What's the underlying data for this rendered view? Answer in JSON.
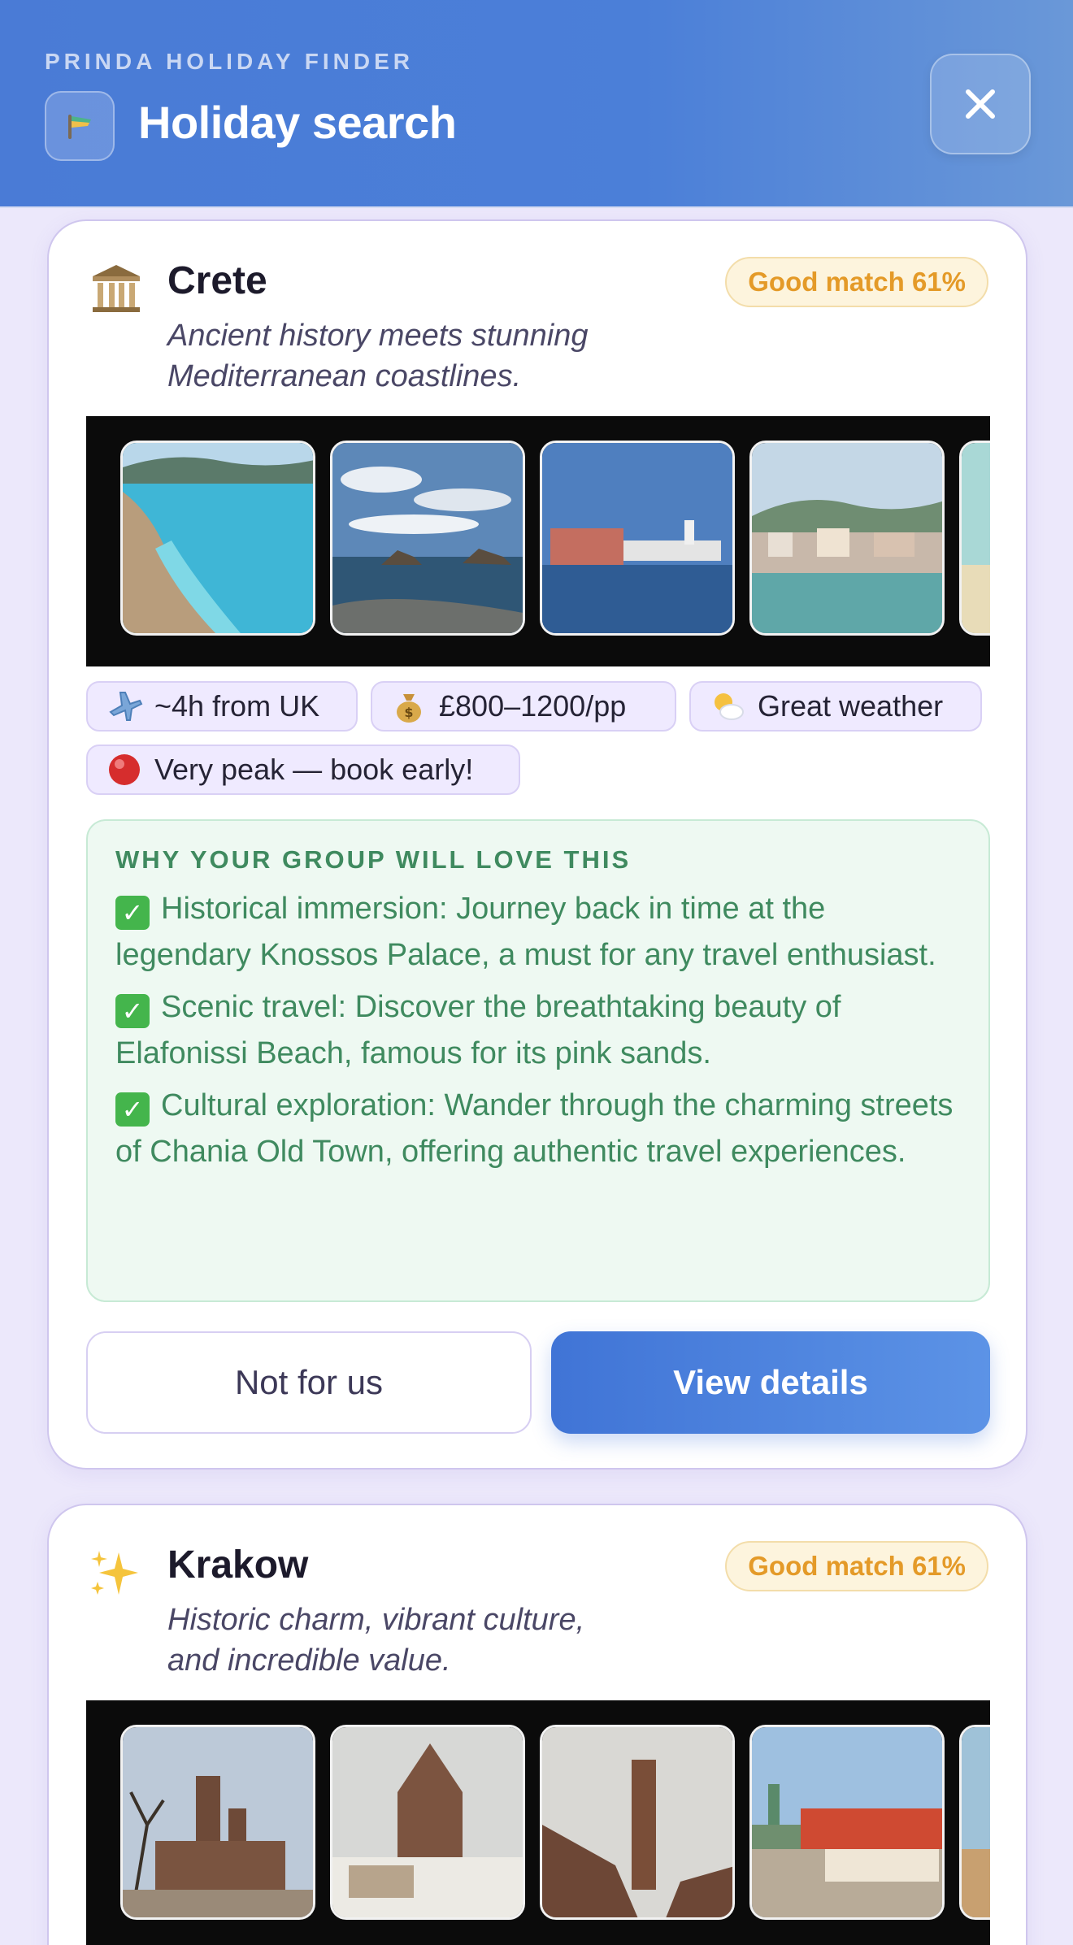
{
  "header": {
    "kicker": "PRINDA HOLIDAY FINDER",
    "title": "Holiday search",
    "logo_icon": "flag-logo-icon",
    "close_icon": "close-icon"
  },
  "results": [
    {
      "icon": "classical-building-icon",
      "title": "Crete",
      "subtitle_line1": "Ancient history meets stunning",
      "subtitle_line2": "Mediterranean coastlines.",
      "match": "Good match 61%",
      "photos": [
        "turquoise-lagoon-photo",
        "rocky-sea-clouds-photo",
        "harbour-building-photo",
        "coastal-town-photo",
        "beach-partial-photo"
      ],
      "chips": {
        "flight": "~4h from UK",
        "price": "£800–1200/pp",
        "weather": "Great weather",
        "peak": "Very peak — book early!"
      },
      "why": {
        "heading": "WHY YOUR GROUP WILL LOVE THIS",
        "items": [
          "Historical immersion: Journey back in time at the legendary Knossos Palace, a must for any travel enthusiast.",
          "Scenic travel: Discover the breathtaking beauty of Elafonissi Beach, famous for its pink sands.",
          "Cultural exploration: Wander through the charming streets of Chania Old Town, offering authentic travel experiences."
        ]
      },
      "buttons": {
        "dismiss": "Not for us",
        "details": "View details"
      }
    },
    {
      "icon": "sparkles-icon",
      "title": "Krakow",
      "subtitle_line1": "Historic charm, vibrant culture,",
      "subtitle_line2": "and incredible value.",
      "match": "Good match 61%",
      "photos": [
        "basilica-trees-photo",
        "church-snow-photo",
        "church-tower-photo",
        "old-town-square-photo",
        "partial-photo"
      ]
    }
  ],
  "colors": {
    "header": "#4a7bd6",
    "match_text": "#e49a28",
    "why_green": "#3f8a5f",
    "primary_button": "#4074d6",
    "page_bg": "#ece8fb"
  }
}
